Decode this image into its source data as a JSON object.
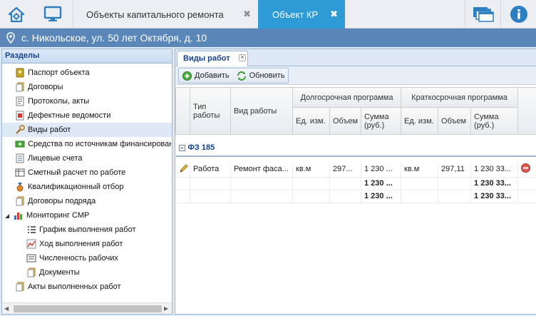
{
  "topbar": {
    "tabs": [
      {
        "label": "Объекты капитального ремонта",
        "active": false
      },
      {
        "label": "Объект КР",
        "active": true
      }
    ],
    "close_glyph": "✖",
    "icons": [
      "home-gear-icon",
      "monitor-icon",
      "windows-icon",
      "info-icon"
    ]
  },
  "address": {
    "text": "с. Никольское, ул. 50 лет Октября, д. 10",
    "icon": "location-pin-icon"
  },
  "sections": {
    "title": "Разделы",
    "items": [
      {
        "label": "Паспорт объекта",
        "icon": "passport-icon"
      },
      {
        "label": "Договоры",
        "icon": "contracts-icon"
      },
      {
        "label": "Протоколы, акты",
        "icon": "protocols-icon"
      },
      {
        "label": "Дефектные ведомости",
        "icon": "defect-sheet-icon"
      },
      {
        "label": "Виды работ",
        "icon": "wrench-icon",
        "selected": true
      },
      {
        "label": "Средства по источникам финансирования",
        "icon": "money-icon"
      },
      {
        "label": "Лицевые счета",
        "icon": "accounts-icon"
      },
      {
        "label": "Сметный расчет по работе",
        "icon": "estimate-icon"
      },
      {
        "label": "Квалификационный отбор",
        "icon": "medal-icon"
      },
      {
        "label": "Договоры подряда",
        "icon": "contract-docs-icon"
      },
      {
        "label": "Мониторинг СМР",
        "icon": "bar-chart-icon",
        "expanded": true
      },
      {
        "label": "График выполнения работ",
        "icon": "schedule-list-icon"
      },
      {
        "label": "Ход выполнения работ",
        "icon": "line-chart-icon"
      },
      {
        "label": "Численность рабочих",
        "icon": "workers-icon"
      },
      {
        "label": "Документы",
        "icon": "documents-icon"
      },
      {
        "label": "Акты выполненных работ",
        "icon": "acts-icon"
      }
    ]
  },
  "panel": {
    "tab_label": "Виды работ",
    "toolbar": {
      "add_label": "Добавить",
      "refresh_label": "Обновить"
    }
  },
  "grid": {
    "headers": {
      "type": "Тип работы",
      "kind": "Вид работы",
      "long": "Долгосрочная программа",
      "short": "Краткосрочная программа",
      "unit": "Ед. изм.",
      "volume": "Объем",
      "sum": "Сумма (руб.)"
    },
    "group": "ФЗ 185",
    "rows": [
      {
        "type": "Работа",
        "kind": "Ремонт фаса...",
        "unit_l": "кв.м",
        "vol_l": "297...",
        "sum_l": "1 230 ...",
        "unit_s": "кв.м",
        "vol_s": "297,11",
        "sum_s": "1 230 33..."
      }
    ],
    "subtotals": [
      {
        "sum_l": "1 230 ...",
        "sum_s": "1 230 33..."
      },
      {
        "sum_l": "1 230 ...",
        "sum_s": "1 230 33..."
      }
    ]
  }
}
